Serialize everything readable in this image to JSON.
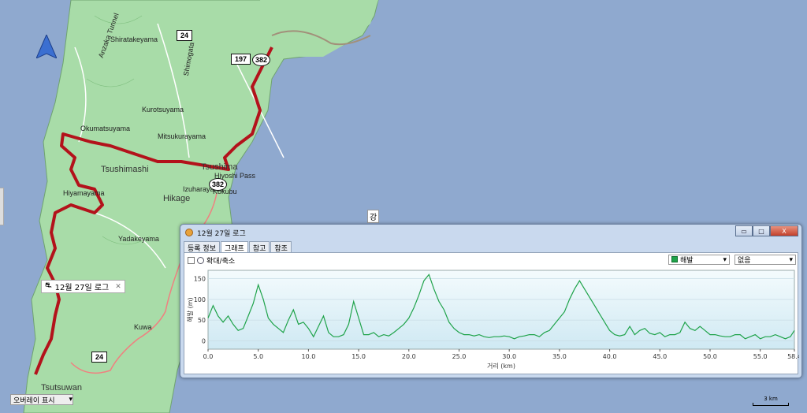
{
  "map": {
    "labels": [
      {
        "text": "Anzaka Tunnel"
      },
      {
        "text": "Shiratakeyama"
      },
      {
        "text": "Shimogata"
      },
      {
        "text": "Okumatsuyama"
      },
      {
        "text": "Mitsukurayama"
      },
      {
        "text": "Tsushimashi"
      },
      {
        "text": "Tsushima"
      },
      {
        "text": "Hiyoshi Pass"
      },
      {
        "text": "Kokubu"
      },
      {
        "text": "Hikage"
      },
      {
        "text": "Izuharayama"
      },
      {
        "text": "Tsutsuwan"
      },
      {
        "text": "Kurotsuyama"
      },
      {
        "text": "Hiyamayama"
      },
      {
        "text": "Yadakeyama"
      },
      {
        "text": "Kuwa"
      }
    ],
    "shields": [
      "24",
      "197",
      "382",
      "382",
      "24"
    ],
    "gang_label": "강",
    "callout_label": "12월 27일 로그",
    "overlay_select": "오버레이 표시",
    "scale": "3 km",
    "colors": {
      "sea": "#8fa9cf",
      "land": "#a8dca8",
      "track": "#b3121b"
    }
  },
  "window": {
    "title": "12월 27일 로그",
    "buttons": {
      "minimize": "▭",
      "maximize": "□",
      "close": "X"
    },
    "tabs": [
      "등록 정보",
      "그래프",
      "참고",
      "참조"
    ],
    "active_tab": "그래프",
    "toolbar": {
      "zoom_label": "확대/축소"
    },
    "series_select": "해발",
    "secondary_select": "없음"
  },
  "chart_data": {
    "type": "line",
    "title": "",
    "xlabel": "거리 (km)",
    "ylabel": "해발 (m)",
    "xlim": [
      0,
      58.4
    ],
    "ylim": [
      -20,
      170
    ],
    "xticks": [
      "0.0",
      "5.0",
      "10.0",
      "15.0",
      "20.0",
      "25.0",
      "30.0",
      "35.0",
      "40.0",
      "45.0",
      "50.0",
      "55.0",
      "58.4"
    ],
    "yticks": [
      "150",
      "100",
      "50",
      "0"
    ],
    "series": [
      {
        "color": "#1fa34a",
        "x": [
          0,
          0.5,
          1,
          1.5,
          2,
          2.5,
          3,
          3.5,
          4,
          4.5,
          5,
          5.5,
          6,
          6.5,
          7,
          7.5,
          8,
          8.5,
          9,
          9.5,
          10,
          10.5,
          11,
          11.5,
          12,
          12.5,
          13,
          13.5,
          14,
          14.5,
          15,
          15.5,
          16,
          16.5,
          17,
          17.5,
          18,
          18.5,
          19,
          19.5,
          20,
          20.5,
          21,
          21.5,
          22,
          22.5,
          23,
          23.5,
          24,
          24.5,
          25,
          25.5,
          26,
          26.5,
          27,
          27.5,
          28,
          28.5,
          29,
          29.5,
          30,
          30.5,
          31,
          31.5,
          32,
          32.5,
          33,
          33.5,
          34,
          34.5,
          35,
          35.5,
          36,
          36.5,
          37,
          37.5,
          38,
          38.5,
          39,
          39.5,
          40,
          40.5,
          41,
          41.5,
          42,
          42.5,
          43,
          43.5,
          44,
          44.5,
          45,
          45.5,
          46,
          46.5,
          47,
          47.5,
          48,
          48.5,
          49,
          49.5,
          50,
          50.5,
          51,
          51.5,
          52,
          52.5,
          53,
          53.5,
          54,
          54.5,
          55,
          55.5,
          56,
          56.5,
          57,
          57.5,
          58,
          58.4
        ],
        "y": [
          55,
          85,
          60,
          45,
          60,
          40,
          25,
          30,
          60,
          90,
          135,
          100,
          55,
          40,
          30,
          20,
          50,
          75,
          40,
          45,
          30,
          10,
          35,
          60,
          20,
          10,
          10,
          15,
          40,
          95,
          55,
          15,
          15,
          20,
          10,
          15,
          12,
          20,
          30,
          40,
          55,
          80,
          110,
          145,
          160,
          125,
          95,
          75,
          45,
          30,
          20,
          15,
          15,
          12,
          15,
          10,
          8,
          10,
          10,
          12,
          10,
          5,
          10,
          12,
          15,
          15,
          10,
          20,
          25,
          40,
          55,
          70,
          100,
          125,
          145,
          125,
          105,
          85,
          65,
          45,
          25,
          15,
          12,
          15,
          35,
          15,
          25,
          30,
          18,
          15,
          20,
          10,
          15,
          15,
          20,
          45,
          30,
          25,
          35,
          25,
          15,
          15,
          12,
          10,
          10,
          15,
          15,
          5,
          10,
          15,
          5,
          10,
          10,
          15,
          10,
          5,
          10,
          25
        ]
      }
    ]
  }
}
